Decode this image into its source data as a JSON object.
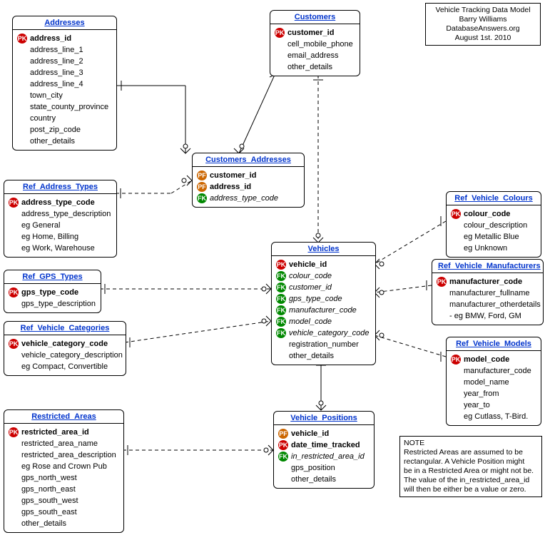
{
  "meta": {
    "title_lines": [
      "Vehicle Tracking Data Model",
      "Barry Williams",
      "DatabaseAnswers.org",
      "August 1st. 2010"
    ]
  },
  "note": {
    "heading": "NOTE",
    "lines": [
      "Restricted Areas are assumed to be",
      "rectangular. A Vehicle Position might",
      "be in a Restricted Area or might not be.",
      "The value of the in_restricted_area_id",
      "will then be either be a value or zero."
    ]
  },
  "entities": {
    "addresses": {
      "name": "Addresses",
      "attrs": [
        {
          "key": "PK",
          "name": "address_id",
          "bold": true
        },
        {
          "key": "",
          "name": "address_line_1"
        },
        {
          "key": "",
          "name": "address_line_2"
        },
        {
          "key": "",
          "name": "address_line_3"
        },
        {
          "key": "",
          "name": "address_line_4"
        },
        {
          "key": "",
          "name": "town_city"
        },
        {
          "key": "",
          "name": "state_county_province"
        },
        {
          "key": "",
          "name": "country"
        },
        {
          "key": "",
          "name": "post_zip_code"
        },
        {
          "key": "",
          "name": "other_details"
        }
      ]
    },
    "customers": {
      "name": "Customers",
      "attrs": [
        {
          "key": "PK",
          "name": "customer_id",
          "bold": true
        },
        {
          "key": "",
          "name": "cell_mobile_phone"
        },
        {
          "key": "",
          "name": "email_address"
        },
        {
          "key": "",
          "name": "other_details"
        }
      ]
    },
    "customers_addresses": {
      "name": "Customers_Addresses",
      "attrs": [
        {
          "key": "PF",
          "name": "customer_id",
          "bold": true
        },
        {
          "key": "PF",
          "name": "address_id",
          "bold": true
        },
        {
          "key": "FK",
          "name": "address_type_code",
          "italic": true
        }
      ]
    },
    "ref_address_types": {
      "name": "Ref_Address_Types",
      "attrs": [
        {
          "key": "PK",
          "name": "address_type_code",
          "bold": true
        },
        {
          "key": "",
          "name": "address_type_description"
        },
        {
          "key": "",
          "name": "eg General"
        },
        {
          "key": "",
          "name": "eg Home, Billing"
        },
        {
          "key": "",
          "name": "eg Work, Warehouse"
        }
      ]
    },
    "ref_gps_types": {
      "name": "Ref_GPS_Types",
      "attrs": [
        {
          "key": "PK",
          "name": "gps_type_code",
          "bold": true
        },
        {
          "key": "",
          "name": "gps_type_description"
        }
      ]
    },
    "ref_vehicle_categories": {
      "name": "Ref_Vehicle_Categories",
      "attrs": [
        {
          "key": "PK",
          "name": "vehicle_category_code",
          "bold": true
        },
        {
          "key": "",
          "name": "vehicle_category_description"
        },
        {
          "key": "",
          "name": "eg Compact, Convertible"
        }
      ]
    },
    "restricted_areas": {
      "name": "Restricted_Areas",
      "attrs": [
        {
          "key": "PK",
          "name": "restricted_area_id",
          "bold": true
        },
        {
          "key": "",
          "name": "restricted_area_name"
        },
        {
          "key": "",
          "name": "restricted_area_description"
        },
        {
          "key": "",
          "name": "eg Rose and Crown Pub"
        },
        {
          "key": "",
          "name": "gps_north_west"
        },
        {
          "key": "",
          "name": "gps_north_east"
        },
        {
          "key": "",
          "name": "gps_south_west"
        },
        {
          "key": "",
          "name": "gps_south_east"
        },
        {
          "key": "",
          "name": "other_details"
        }
      ]
    },
    "vehicles": {
      "name": "Vehicles",
      "attrs": [
        {
          "key": "PK",
          "name": "vehicle_id",
          "bold": true
        },
        {
          "key": "FK",
          "name": "colour_code",
          "italic": true
        },
        {
          "key": "FK",
          "name": "customer_id",
          "italic": true
        },
        {
          "key": "FK",
          "name": "gps_type_code",
          "italic": true
        },
        {
          "key": "FK",
          "name": "manufacturer_code",
          "italic": true
        },
        {
          "key": "FK",
          "name": "model_code",
          "italic": true
        },
        {
          "key": "FK",
          "name": "vehicle_category_code",
          "italic": true
        },
        {
          "key": "",
          "name": "registration_number"
        },
        {
          "key": "",
          "name": "other_details"
        }
      ]
    },
    "ref_vehicle_colours": {
      "name": "Ref_Vehicle_Colours",
      "attrs": [
        {
          "key": "PK",
          "name": "colour_code",
          "bold": true
        },
        {
          "key": "",
          "name": "colour_description"
        },
        {
          "key": "",
          "name": "eg Metallic Blue"
        },
        {
          "key": "",
          "name": "eg Unknown"
        }
      ]
    },
    "ref_vehicle_manufacturers": {
      "name": "Ref_Vehicle_Manufacturers",
      "attrs": [
        {
          "key": "PK",
          "name": "manufacturer_code",
          "bold": true
        },
        {
          "key": "",
          "name": "manufacturer_fullname"
        },
        {
          "key": "",
          "name": "manufacturer_otherdetails"
        },
        {
          "key": "",
          "name": "- eg BMW, Ford, GM"
        }
      ]
    },
    "ref_vehicle_models": {
      "name": "Ref_Vehicle_Models",
      "attrs": [
        {
          "key": "PK",
          "name": "model_code",
          "bold": true
        },
        {
          "key": "",
          "name": "manufacturer_code"
        },
        {
          "key": "",
          "name": "model_name"
        },
        {
          "key": "",
          "name": "year_from"
        },
        {
          "key": "",
          "name": "year_to"
        },
        {
          "key": "",
          "name": "eg Cutlass, T-Bird."
        }
      ]
    },
    "vehicle_positions": {
      "name": "Vehicle_Positions",
      "attrs": [
        {
          "key": "PF",
          "name": "vehicle_id",
          "bold": true
        },
        {
          "key": "PK",
          "name": "date_time_tracked",
          "bold": true
        },
        {
          "key": "FK",
          "name": "in_restricted_area_id",
          "italic": true
        },
        {
          "key": "",
          "name": "gps_position"
        },
        {
          "key": "",
          "name": "other_details"
        }
      ]
    }
  }
}
